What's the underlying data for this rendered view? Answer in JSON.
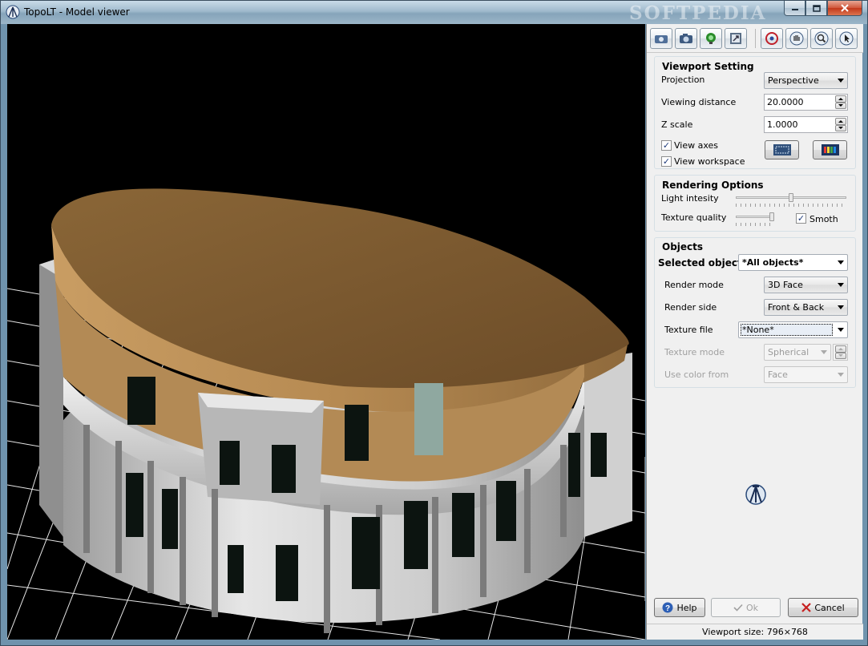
{
  "window": {
    "title": "TopoLT - Model viewer",
    "watermark": "SOFTPEDIA",
    "caption_buttons": [
      "minimize",
      "maximize",
      "close"
    ]
  },
  "toolbar": {
    "buttons": [
      {
        "name": "screenshot-icon"
      },
      {
        "name": "camera-icon"
      },
      {
        "name": "light-icon"
      },
      {
        "name": "export-icon"
      },
      {
        "name": "rotate-icon"
      },
      {
        "name": "pan-hand-icon"
      },
      {
        "name": "zoom-icon"
      },
      {
        "name": "select-pointer-icon"
      }
    ]
  },
  "viewport_settings": {
    "title": "Viewport Setting",
    "projection_label": "Projection",
    "projection_value": "Perspective",
    "viewing_distance_label": "Viewing distance",
    "viewing_distance_value": "20.0000",
    "z_scale_label": "Z scale",
    "z_scale_value": "1.0000",
    "view_axes_label": "View axes",
    "view_axes_checked": true,
    "view_workspace_label": "View workspace",
    "view_workspace_checked": true
  },
  "rendering_options": {
    "title": "Rendering Options",
    "light_intensity_label": "Light intesity",
    "light_intensity_level": 0.5,
    "texture_quality_label": "Texture quality",
    "texture_quality_level": 1.0,
    "smooth_label": "Smoth",
    "smooth_checked": true
  },
  "objects": {
    "title": "Objects",
    "selected_object_label": "Selected object",
    "selected_object_value": "*All objects*",
    "render_mode_label": "Render mode",
    "render_mode_value": "3D Face",
    "render_side_label": "Render side",
    "render_side_value": "Front & Back",
    "texture_file_label": "Texture file",
    "texture_file_value": "*None*",
    "texture_mode_label": "Texture mode",
    "texture_mode_value": "Spherical",
    "use_color_from_label": "Use color from",
    "use_color_from_value": "Face"
  },
  "buttons": {
    "help": "Help",
    "ok": "Ok",
    "cancel": "Cancel"
  },
  "status": {
    "viewport_size": "Viewport size: 796×768"
  },
  "colors": {
    "roof": "#7c5a34",
    "wall": "#c4c4c4",
    "grid": "#ffffff",
    "title_bar": "#9fb9cc"
  }
}
